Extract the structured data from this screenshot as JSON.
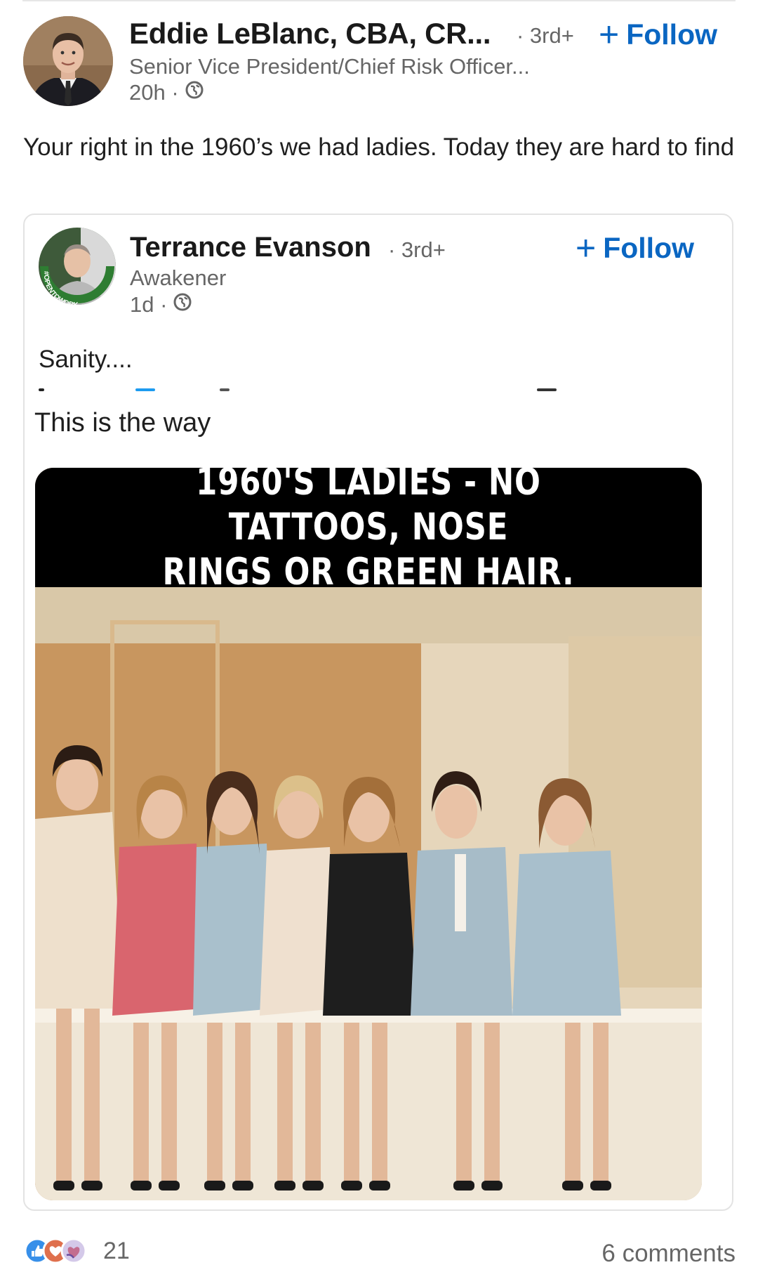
{
  "outer_post": {
    "author_name": "Eddie LeBlanc, CBA, CR...",
    "degree": "· 3rd+",
    "follow_label": "Follow",
    "headline": "Senior Vice President/Chief Risk Officer...",
    "time": "20h ·",
    "visibility_icon": "globe-icon",
    "text": "Your right in the 1960’s we had ladies. Today they are hard to find"
  },
  "shared_post": {
    "author_name": "Terrance Evanson",
    "degree": "· 3rd+",
    "follow_label": "Follow",
    "headline": "Awakener",
    "time": "1d ·",
    "visibility_icon": "globe-icon",
    "avatar_frame_text": "#OPENTOWORK",
    "text": "Sanity....",
    "subtext": "This is the way",
    "image": {
      "caption_line1": "1960'S LADIES - NO TATTOOS, NOSE",
      "caption_line2": "RINGS OR GREEN HAIR."
    }
  },
  "footer": {
    "reaction_icons": [
      "like-icon",
      "love-icon",
      "support-icon"
    ],
    "reaction_count": "21",
    "comments": "6 comments"
  },
  "colors": {
    "accent": "#0a66c2",
    "secondary_text": "#666666",
    "banner": "#000000"
  }
}
